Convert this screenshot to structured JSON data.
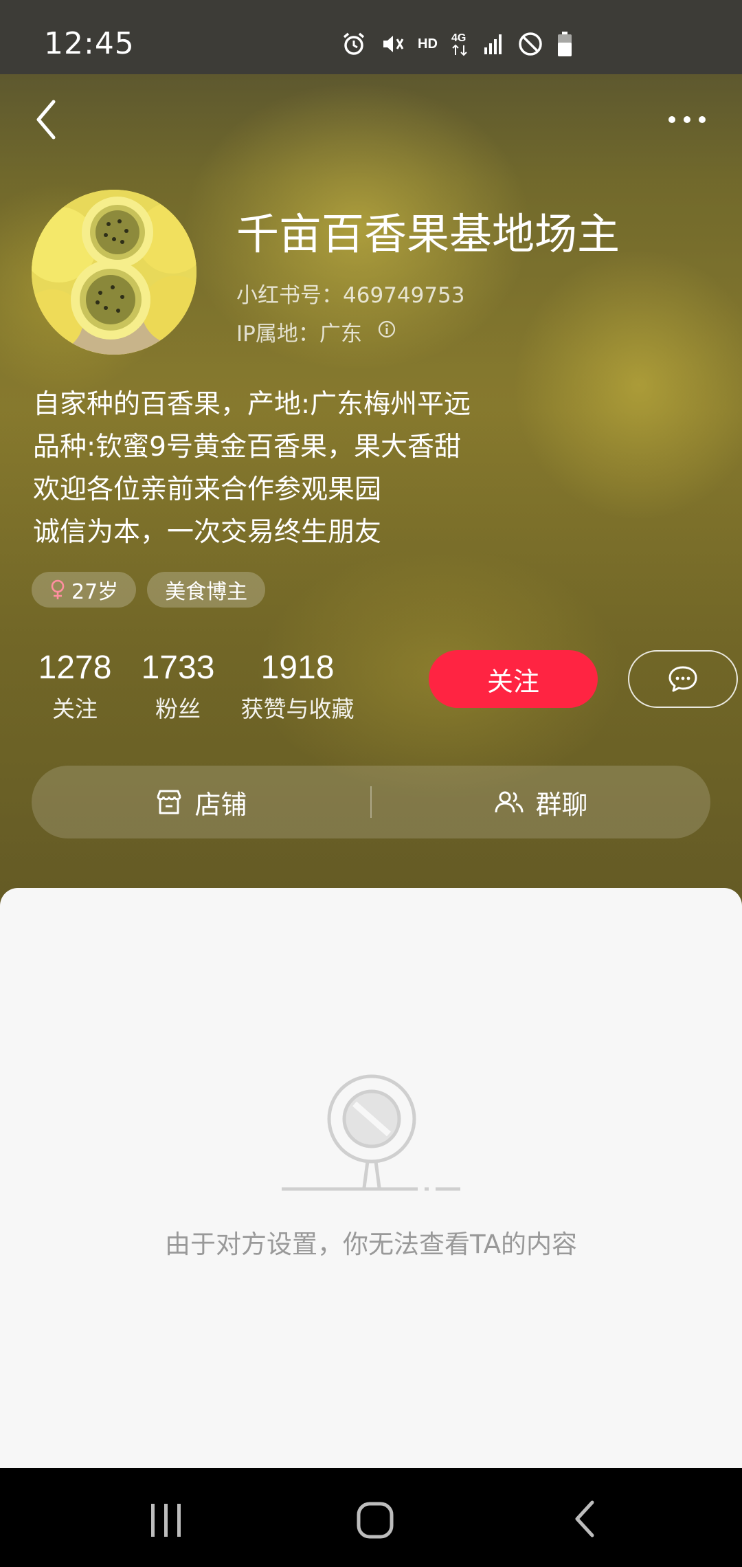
{
  "status_bar": {
    "time": "12:45",
    "hd_label": "HD",
    "network_label": "4G",
    "icons": [
      "alarm-icon",
      "mute-icon",
      "hd-icon",
      "4g-icon",
      "signal-icon",
      "do-not-disturb-icon",
      "battery-icon"
    ]
  },
  "nav": {
    "back_icon": "chevron-left-icon",
    "more_icon": "more-dots-icon"
  },
  "profile": {
    "username": "千亩百香果基地场主",
    "id_line": "小红书号：469749753",
    "ip_line": "IP属地：广东",
    "bio": [
      "自家种的百香果，产地:广东梅州平远",
      "品种:钦蜜9号黄金百香果，果大香甜",
      "欢迎各位亲前来合作参观果园",
      "诚信为本，一次交易终生朋友"
    ],
    "tags": [
      {
        "label": "27岁",
        "icon": "female-icon"
      },
      {
        "label": "美食博主"
      }
    ]
  },
  "stats": [
    {
      "value": "1278",
      "label": "关注"
    },
    {
      "value": "1733",
      "label": "粉丝"
    },
    {
      "value": "1918",
      "label": "获赞与收藏"
    }
  ],
  "buttons": {
    "follow": "关注",
    "chat_icon": "message-bubble-icon"
  },
  "actions": {
    "shop": "店铺",
    "group_chat": "群聊"
  },
  "content": {
    "blocked_message": "由于对方设置，你无法查看TA的内容"
  },
  "colors": {
    "accent": "#ff2442",
    "hero_tint": "#7c7330",
    "muted_text": "#999999"
  }
}
